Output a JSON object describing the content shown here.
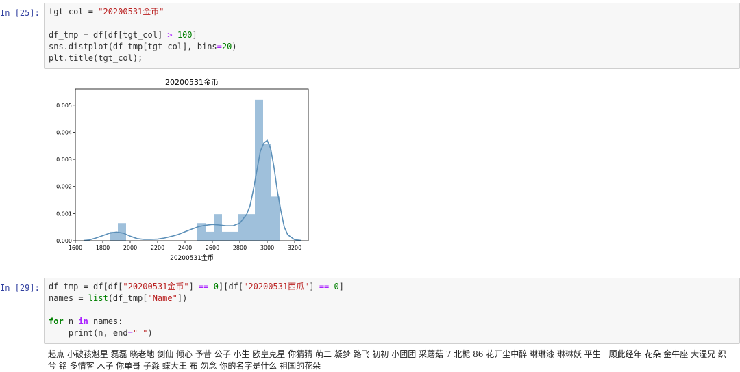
{
  "cells": [
    {
      "prompt": "In [25]:",
      "lines": [
        [
          {
            "t": "tgt_col = "
          },
          {
            "t": "\"20200531金币\"",
            "c": "str"
          }
        ],
        [],
        [
          {
            "t": "df_tmp = df[df[tgt_col] "
          },
          {
            "t": ">",
            "c": "op"
          },
          {
            "t": " "
          },
          {
            "t": "100",
            "c": "num"
          },
          {
            "t": "]"
          }
        ],
        [
          {
            "t": "sns.distplot(df_tmp[tgt_col], bins"
          },
          {
            "t": "=",
            "c": "op"
          },
          {
            "t": "20",
            "c": "num"
          },
          {
            "t": ")"
          }
        ],
        [
          {
            "t": "plt.title(tgt_col);"
          }
        ]
      ]
    },
    {
      "prompt": "In [29]:",
      "lines": [
        [
          {
            "t": "df_tmp = df[df["
          },
          {
            "t": "\"20200531金币\"",
            "c": "str"
          },
          {
            "t": "] "
          },
          {
            "t": "==",
            "c": "op"
          },
          {
            "t": " "
          },
          {
            "t": "0",
            "c": "num"
          },
          {
            "t": "][df["
          },
          {
            "t": "\"20200531西瓜\"",
            "c": "str"
          },
          {
            "t": "] "
          },
          {
            "t": "==",
            "c": "op"
          },
          {
            "t": " "
          },
          {
            "t": "0",
            "c": "num"
          },
          {
            "t": "]"
          }
        ],
        [
          {
            "t": "names = "
          },
          {
            "t": "list",
            "c": "fn"
          },
          {
            "t": "(df_tmp["
          },
          {
            "t": "\"Name\"",
            "c": "str"
          },
          {
            "t": "])"
          }
        ],
        [],
        [
          {
            "t": "for",
            "c": "kw"
          },
          {
            "t": " n "
          },
          {
            "t": "in",
            "c": "kwo"
          },
          {
            "t": " names:"
          }
        ],
        [
          {
            "t": "    print(n, end"
          },
          {
            "t": "=",
            "c": "op"
          },
          {
            "t": "\" \"",
            "c": "str"
          },
          {
            "t": ")"
          }
        ]
      ]
    }
  ],
  "output_text": "起点 小破孩魁星 磊磊 晓老地 剑仙 倾心 予昔 公子 小生 欧皇克星 你猜猜 萌二 凝梦 路飞 初初 小团团 采蘑菇 7 北栀 86 花开尘中醉 琳琳漆 琳琳妖 平生一顾此经年 花朵 金牛座 大湿兄 织兮 铭 多情客 木子 你单哥 子淼 蝶大王 布 勿念 你的名字是什么 祖国的花朵",
  "chart_data": {
    "type": "histogram",
    "title": "20200531金币",
    "xlabel": "20200531金币",
    "ylabel": "",
    "xlim": [
      1600,
      3300
    ],
    "ylim": [
      0,
      0.0056
    ],
    "xticks": [
      1600,
      1800,
      2000,
      2200,
      2400,
      2600,
      2800,
      3000,
      3200
    ],
    "yticks": [
      0.0,
      0.001,
      0.002,
      0.003,
      0.004,
      0.005
    ],
    "ytick_labels": [
      "0.000",
      "0.001",
      "0.002",
      "0.003",
      "0.004",
      "0.005"
    ],
    "bins": [
      {
        "x0": 1850,
        "x1": 1910,
        "density": 0.00033
      },
      {
        "x0": 1910,
        "x1": 1970,
        "density": 0.00065
      },
      {
        "x0": 2490,
        "x1": 2550,
        "density": 0.00065
      },
      {
        "x0": 2550,
        "x1": 2610,
        "density": 0.00033
      },
      {
        "x0": 2610,
        "x1": 2670,
        "density": 0.00098
      },
      {
        "x0": 2670,
        "x1": 2730,
        "density": 0.00033
      },
      {
        "x0": 2730,
        "x1": 2790,
        "density": 0.00033
      },
      {
        "x0": 2790,
        "x1": 2850,
        "density": 0.00098
      },
      {
        "x0": 2850,
        "x1": 2910,
        "density": 0.00098
      },
      {
        "x0": 2910,
        "x1": 2970,
        "density": 0.0052
      },
      {
        "x0": 2970,
        "x1": 3030,
        "density": 0.00358
      },
      {
        "x0": 3030,
        "x1": 3090,
        "density": 0.00163
      }
    ],
    "kde": [
      [
        1660,
        1e-05
      ],
      [
        1700,
        3e-05
      ],
      [
        1750,
        0.0001
      ],
      [
        1800,
        0.00019
      ],
      [
        1850,
        0.00028
      ],
      [
        1900,
        0.00032
      ],
      [
        1950,
        0.00028
      ],
      [
        2000,
        0.00017
      ],
      [
        2050,
        8e-05
      ],
      [
        2100,
        5e-05
      ],
      [
        2150,
        5e-05
      ],
      [
        2200,
        6e-05
      ],
      [
        2250,
        0.0001
      ],
      [
        2300,
        0.00016
      ],
      [
        2350,
        0.00023
      ],
      [
        2400,
        0.00033
      ],
      [
        2450,
        0.00043
      ],
      [
        2500,
        0.00052
      ],
      [
        2550,
        0.00057
      ],
      [
        2600,
        0.0006
      ],
      [
        2650,
        0.00058
      ],
      [
        2700,
        0.00055
      ],
      [
        2750,
        0.00055
      ],
      [
        2800,
        0.00065
      ],
      [
        2850,
        0.00097
      ],
      [
        2875,
        0.0013
      ],
      [
        2900,
        0.0019
      ],
      [
        2925,
        0.0026
      ],
      [
        2950,
        0.0033
      ],
      [
        2975,
        0.0036
      ],
      [
        3000,
        0.0037
      ],
      [
        3025,
        0.0034
      ],
      [
        3050,
        0.0027
      ],
      [
        3075,
        0.0018
      ],
      [
        3100,
        0.0011
      ],
      [
        3125,
        0.0005
      ],
      [
        3150,
        0.00022
      ],
      [
        3200,
        4e-05
      ],
      [
        3250,
        1e-05
      ]
    ],
    "bar_color": "#9fc0db",
    "line_color": "#5b8fb8"
  }
}
